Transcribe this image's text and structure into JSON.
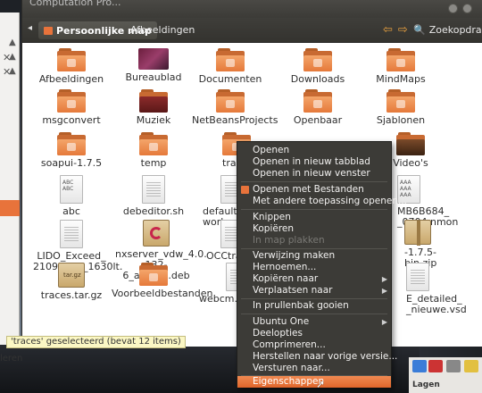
{
  "window": {
    "title": "Computation Pro..."
  },
  "breadcrumb": {
    "active": "Persoonlijke map",
    "next": "Afbeeldingen"
  },
  "search": {
    "label": "Zoekopdracht"
  },
  "items": [
    {
      "label": "Afbeeldingen",
      "kind": "folder"
    },
    {
      "label": "Bureaublad",
      "kind": "desktop"
    },
    {
      "label": "Documenten",
      "kind": "folder"
    },
    {
      "label": "Downloads",
      "kind": "folder"
    },
    {
      "label": "MindMaps",
      "kind": "folder"
    },
    {
      "label": "msgconvert",
      "kind": "folder"
    },
    {
      "label": "Muziek",
      "kind": "music"
    },
    {
      "label": "NetBeansProjects",
      "kind": "folder"
    },
    {
      "label": "Openbaar",
      "kind": "folder"
    },
    {
      "label": "Sjablonen",
      "kind": "folder"
    },
    {
      "label": "soapui-1.7.5",
      "kind": "folder"
    },
    {
      "label": "temp",
      "kind": "folder"
    },
    {
      "label": "trac",
      "kind": "folder"
    },
    {
      "label": "Video's",
      "kind": "video"
    },
    {
      "label": "abc",
      "kind": "file"
    },
    {
      "label": "debeditor.sh",
      "kind": "file"
    },
    {
      "label": "default-s workspa",
      "kind": "file"
    },
    {
      "label": "MB6B684_ _0704.nmon",
      "kind": "file"
    },
    {
      "label": "LIDO_Exceed_ 21092011_1630lt. pcap",
      "kind": "file"
    },
    {
      "label": "nxserver_vdw_4.0. 132-6_amd64.deb",
      "kind": "deb"
    },
    {
      "label": "OCCtrac",
      "kind": "file"
    },
    {
      "label": "-1.7.5-bin.zip",
      "kind": "archive"
    },
    {
      "label": "traces.tar.gz",
      "kind": "archive"
    },
    {
      "label": "Voorbeeldbestanden",
      "kind": "folder"
    },
    {
      "label": "webcm.jvm",
      "kind": "file"
    },
    {
      "label": "E_detailed_ _nieuwe.vsd",
      "kind": "file"
    }
  ],
  "context_menu": {
    "items": [
      {
        "label": "Openen"
      },
      {
        "label": "Openen in nieuw tabblad"
      },
      {
        "label": "Openen in nieuw venster"
      },
      {
        "label": "Openen met Bestanden"
      },
      {
        "label": "Met andere toepassing openen..."
      },
      {
        "label": "Knippen"
      },
      {
        "label": "Kopiëren"
      },
      {
        "label": "In map plakken"
      },
      {
        "label": "Verwijzing maken"
      },
      {
        "label": "Hernoemen..."
      },
      {
        "label": "Kopiëren naar"
      },
      {
        "label": "Verplaatsen naar"
      },
      {
        "label": "In prullenbak gooien"
      },
      {
        "label": "Ubuntu One"
      },
      {
        "label": "Deelopties"
      },
      {
        "label": "Comprimeren..."
      },
      {
        "label": "Herstellen naar vorige versie..."
      },
      {
        "label": "Versturen naar..."
      },
      {
        "label": "Eigenschappen"
      }
    ]
  },
  "status": {
    "text": "'traces' geselecteerd (bevat 12 items)"
  },
  "left_panel": {
    "bottom_text": "leren"
  },
  "right_panel": {
    "label": "Lagen"
  },
  "colors": {
    "accent": "#e8733b",
    "menu_bg": "#3c3b37",
    "toolbar_bg": "#3c3b37"
  }
}
